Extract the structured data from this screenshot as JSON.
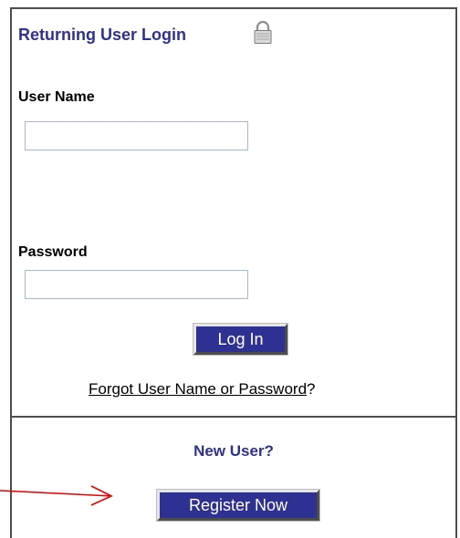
{
  "login": {
    "title": "Returning User Login",
    "icon": "lock-icon",
    "username_label": "User Name",
    "username_value": "",
    "password_label": "Password",
    "password_value": "",
    "login_button": "Log In",
    "forgot_link": "Forgot User Name or Password",
    "forgot_suffix": "?"
  },
  "new_user": {
    "title": "New User?",
    "register_button": "Register Now"
  },
  "colors": {
    "accent": "#2e3192",
    "annotation_arrow": "#e60000",
    "border": "#4d4d4d"
  }
}
